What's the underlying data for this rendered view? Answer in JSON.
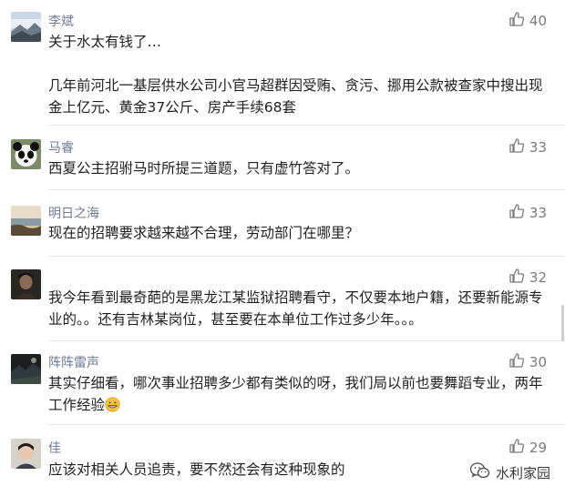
{
  "comments": [
    {
      "name": "李斌",
      "likes": "40",
      "avatar": "landscape-avatar",
      "text": "关于水太有钱了…\n\n几年前河北一基层供水公司小官马超群因受贿、贪污、挪用公款被查家中搜出现金上亿元、黄金37公斤、房产手续68套"
    },
    {
      "name": "马睿",
      "likes": "33",
      "avatar": "panda-avatar",
      "text": "西夏公主招驸马时所提三道题，只有虚竹答对了。"
    },
    {
      "name": "明日之海",
      "likes": "33",
      "avatar": "sea-avatar",
      "text": "现在的招聘要求越来越不合理，劳动部门在哪里？"
    },
    {
      "name": "",
      "likes": "32",
      "avatar": "dark-portrait-avatar",
      "text": "我今年看到最奇葩的是黑龙江某监狱招聘看守，不仅要本地户籍，还要新能源专业的。。还有吉林某岗位，甚至要在本单位工作过多少年。。。"
    },
    {
      "name": "阵阵雷声",
      "likes": "30",
      "avatar": "night-avatar",
      "text": "其实仔细看，哪次事业招聘多少都有类似的呀，我们局以前也要舞蹈专业，两年工作经验",
      "emoji": "grinning-face-emoji"
    },
    {
      "name": "佳",
      "likes": "29",
      "avatar": "child-avatar",
      "text": "应该对相关人员追责，要不然还会有这种现象的"
    }
  ],
  "watermark": {
    "label": "水利家园",
    "icon": "wechat-icon"
  },
  "icons": {
    "like": "thumbs-up-icon"
  },
  "colors": {
    "name": "#6d7a94",
    "text": "#1f1f1f",
    "like": "#7a7a7a"
  }
}
